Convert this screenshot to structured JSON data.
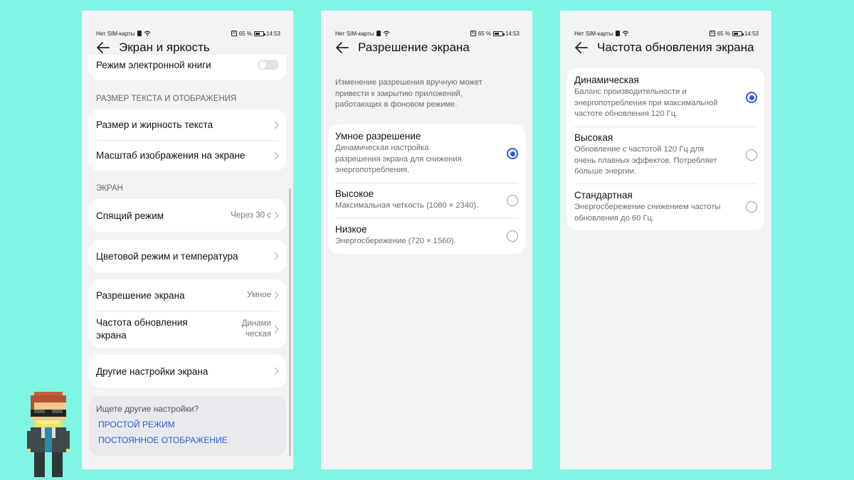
{
  "status_bar": {
    "sim": "Нет SIM-карты",
    "battery": "65 %",
    "time": "14:53"
  },
  "screen1": {
    "title": "Экран и яркость",
    "top_item": "Режим электронной книги",
    "section1": "РАЗМЕР ТЕКСТА И ОТОБРАЖЕНИЯ",
    "text_size": "Размер и жирность текста",
    "display_scale": "Масштаб изображения на экране",
    "section2": "ЭКРАН",
    "sleep": {
      "label": "Спящий режим",
      "value": "Через 30 с"
    },
    "color_mode": "Цветовой режим и температура",
    "resolution": {
      "label": "Разрешение экрана",
      "value": "Умное"
    },
    "refresh": {
      "label_1": "Частота обновления",
      "label_2": "экрана",
      "value_1": "Динами",
      "value_2": "ческая"
    },
    "other": "Другие настройки экрана",
    "search_prompt": "Ищете другие настройки?",
    "link1": "ПРОСТОЙ РЕЖИМ",
    "link2": "ПОСТОЯННОЕ ОТОБРАЖЕНИЕ"
  },
  "screen2": {
    "title": "Разрешение экрана",
    "note": [
      "Изменение разрешения вручную может",
      "привести к закрытию приложений,",
      "работающих в фоновом режиме."
    ],
    "options": [
      {
        "title": "Умное разрешение",
        "desc": [
          "Динамическая настройка",
          "разрешения экрана для снижения",
          "энергопотребления."
        ],
        "selected": true
      },
      {
        "title": "Высокое",
        "desc": [
          "Максимальная четкость (1080 × 2340)."
        ],
        "selected": false
      },
      {
        "title": "Низкое",
        "desc": [
          "Энергосбережение (720 × 1560)."
        ],
        "selected": false
      }
    ]
  },
  "screen3": {
    "title": "Частота обновления экрана",
    "options": [
      {
        "title": "Динамическая",
        "desc": [
          "Баланс производительности и",
          "энергопотребления при максимальной",
          "частоте обновления 120 Гц."
        ],
        "selected": true
      },
      {
        "title": "Высокая",
        "desc": [
          "Обновление с частотой 120 Гц для",
          "очень плавных эффектов. Потребляет",
          "больше энергии."
        ],
        "selected": false
      },
      {
        "title": "Стандартная",
        "desc": [
          "Энергосбережение снижением частоты",
          "обновления до 60 Гц."
        ],
        "selected": false
      }
    ]
  },
  "colors": {
    "background": "#7ff5e3",
    "accent": "#2a5bd7",
    "panel": "#f1f3f5"
  }
}
